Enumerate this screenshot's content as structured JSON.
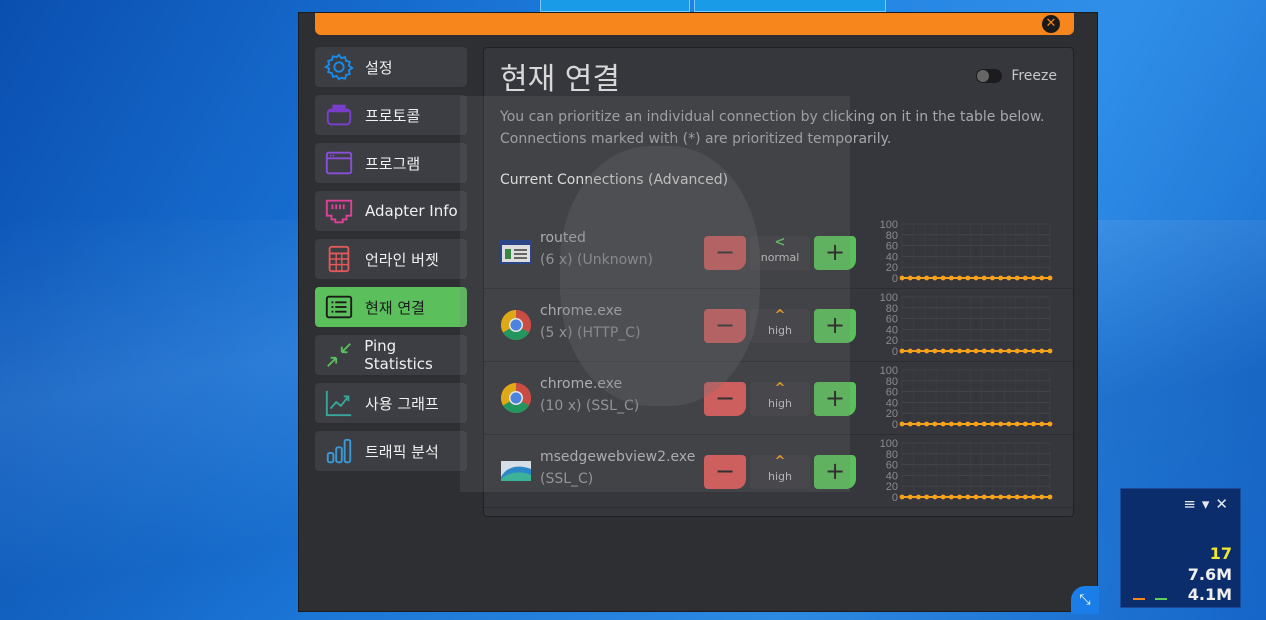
{
  "window": {
    "close_glyph": "✕",
    "title": "현재 연결",
    "freeze_label": "Freeze",
    "description_line1": "You can prioritize an individual connection by clicking on it in the table below.",
    "description_line2": "Connections marked with (*) are prioritized temporarily.",
    "subheading": "Current Connections (Advanced)"
  },
  "sidebar": {
    "items": [
      {
        "label": "설정",
        "icon": "gear-icon",
        "color": "#1a8be8"
      },
      {
        "label": "프로토콜",
        "icon": "layers-icon",
        "color": "#7b3fd0"
      },
      {
        "label": "프로그램",
        "icon": "window-icon",
        "color": "#8a4fd8"
      },
      {
        "label": "Adapter Info",
        "icon": "ethernet-icon",
        "color": "#e0409a"
      },
      {
        "label": "언라인 버젯",
        "icon": "calculator-icon",
        "color": "#e05a5a"
      },
      {
        "label": "현재 연결",
        "icon": "list-icon",
        "color": "#1a1a1a"
      },
      {
        "label": "Ping Statistics",
        "icon": "compress-icon",
        "color": "#5bbf5b"
      },
      {
        "label": "사용 그래프",
        "icon": "trend-icon",
        "color": "#3aa59a"
      },
      {
        "label": "트래픽 분석",
        "icon": "bar-chart-icon",
        "color": "#3a9ad9"
      }
    ]
  },
  "connections": [
    {
      "name": "routed",
      "detail": "(6 x) (Unknown)",
      "priority": "normal",
      "arrow": "<",
      "icon": "routed-app-icon"
    },
    {
      "name": "chrome.exe",
      "detail": "(5 x) (HTTP_C)",
      "priority": "high",
      "arrow": "^",
      "icon": "chrome-icon"
    },
    {
      "name": "chrome.exe",
      "detail": "(10 x) (SSL_C)",
      "priority": "high",
      "arrow": "^",
      "icon": "chrome-icon"
    },
    {
      "name": "msedgewebview2.exe",
      "detail": "(SSL_C)",
      "priority": "high",
      "arrow": "^",
      "icon": "edge-webview-icon"
    }
  ],
  "buttons": {
    "minus": "−",
    "plus": "+"
  },
  "mini_chart": {
    "y_ticks": [
      "100",
      "80",
      "60",
      "40",
      "20",
      "0"
    ],
    "series_color": "#f7a21c",
    "values": [
      0,
      0,
      0,
      0,
      0,
      0,
      0,
      0,
      0,
      0,
      0,
      0,
      0,
      0,
      0,
      0,
      0,
      0,
      0
    ]
  },
  "tray": {
    "controls": "≡▾✕",
    "ping": "17",
    "download": "7.6M",
    "upload": "4.1M"
  },
  "colors": {
    "accent_orange": "#f7861c",
    "accent_green": "#5bbf5b",
    "accent_red": "#e05a5a"
  }
}
